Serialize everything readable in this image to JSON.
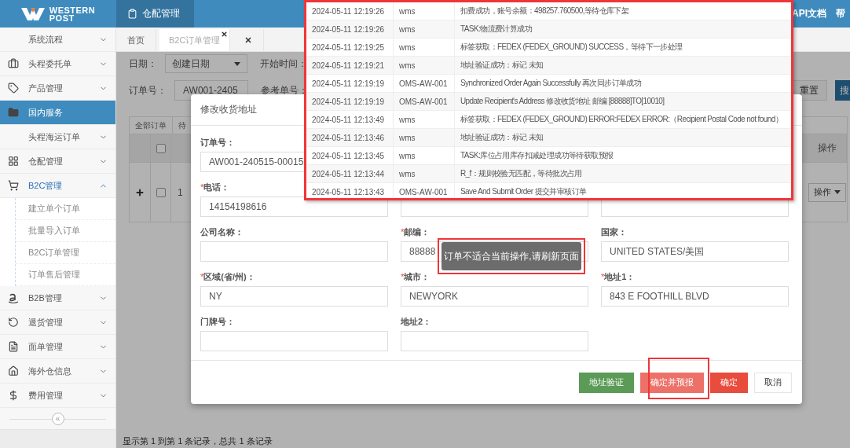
{
  "top_bar": {
    "logo": {
      "line_1": "WESTERN",
      "line_2": "POST"
    },
    "module_tab": "仓配管理",
    "links": [
      "API文档",
      "帮"
    ]
  },
  "sidebar": {
    "items": [
      {
        "label": "系统流程",
        "selected": false,
        "expanded": false
      },
      {
        "label": "头程委托单",
        "selected": false,
        "expanded": false
      },
      {
        "label": "产品管理",
        "selected": false,
        "expanded": false
      },
      {
        "label": "国内服务",
        "selected": true,
        "expanded": false
      },
      {
        "label": "头程海运订单",
        "selected": false,
        "expanded": false
      },
      {
        "label": "仓配管理",
        "selected": false,
        "expanded": false
      },
      {
        "label": "B2C管理",
        "selected": false,
        "expanded": true,
        "children": [
          {
            "label": "建立单个订单"
          },
          {
            "label": "批量导入订单"
          },
          {
            "label": "B2C订单管理"
          },
          {
            "label": "订单售后管理"
          }
        ]
      },
      {
        "label": "B2B管理",
        "selected": false,
        "expanded": false
      },
      {
        "label": "退货管理",
        "selected": false,
        "expanded": false
      },
      {
        "label": "面单管理",
        "selected": false,
        "expanded": false
      },
      {
        "label": "海外仓信息",
        "selected": false,
        "expanded": false
      },
      {
        "label": "费用管理",
        "selected": false,
        "expanded": false
      }
    ],
    "collapse_mark": "«"
  },
  "tabs": [
    {
      "label": "首页",
      "selected": false,
      "closable": false
    },
    {
      "label": "B2C订单管理",
      "selected": true,
      "closable": true
    },
    {
      "selected": false,
      "closable": true
    }
  ],
  "filters": {
    "date_label": "日期：",
    "date_select": "创建日期",
    "start_label": "开始时间：",
    "order_label": "订单号：",
    "order_value": "AW001-2405",
    "ref_label": "参考单号：",
    "reset_button": "重置",
    "search_button": "搜"
  },
  "table": {
    "status_tabs": [
      "全部订单",
      "待"
    ],
    "header_checked": false,
    "action_header": "操作",
    "rows": [
      {
        "index": "1",
        "checked": false,
        "action": "操作"
      }
    ]
  },
  "pager_text": "显示第 1 到第 1 条记录，总共 1 条记录",
  "modal": {
    "title": "修改收货地址",
    "required_mark": "*",
    "rows": [
      [
        {
          "label": "订单号：",
          "required": false,
          "value": "AW001-240515-00015"
        },
        null,
        null
      ],
      [
        {
          "label": "电话：",
          "required": true,
          "value": "14154198616"
        },
        {},
        {}
      ],
      [
        {
          "label": "公司名称：",
          "required": false
        },
        {
          "label": "邮编：",
          "required": true,
          "value": "88888"
        },
        {
          "label": "国家：",
          "required": false,
          "value": "UNITED STATES/美国"
        }
      ],
      [
        {
          "label": "区域(省/州)：",
          "required": true,
          "value": "NY"
        },
        {
          "label": "城市：",
          "required": true,
          "value": "NEWYORK"
        },
        {
          "label": "地址1：",
          "required": true,
          "value": "843 E FOOTHILL BLVD"
        }
      ],
      [
        {
          "label": "门牌号：",
          "required": false
        },
        {
          "label": "地址2：",
          "required": false
        },
        null
      ]
    ],
    "buttons": [
      {
        "label": "地址验证",
        "kind": "success"
      },
      {
        "label": "确定并预报",
        "kind": "light-danger"
      },
      {
        "label": "确定",
        "kind": "danger"
      },
      {
        "label": "取消",
        "kind": "default"
      }
    ]
  },
  "log": {
    "rows": [
      {
        "time": "2024-05-11 12:19:26",
        "source": "wms",
        "message": "扣费成功，账号余额：498257.760500,等待仓库下架"
      },
      {
        "time": "2024-05-11 12:19:26",
        "source": "wms",
        "message": "TASK:物流费计算成功"
      },
      {
        "time": "2024-05-11 12:19:25",
        "source": "wms",
        "message": "标签获取：FEDEX (FEDEX_GROUND) SUCCESS，等待下一步处理"
      },
      {
        "time": "2024-05-11 12:19:21",
        "source": "wms",
        "message": "地址验证成功：标记 未知"
      },
      {
        "time": "2024-05-11 12:19:19",
        "source": "OMS-AW-001",
        "message": "Synchronized Order Again Successfully 再次同步订单成功"
      },
      {
        "time": "2024-05-11 12:19:19",
        "source": "OMS-AW-001",
        "message": "Update Recipient's Address 修改收货地址 邮编 [88888]TO[10010]"
      },
      {
        "time": "2024-05-11 12:13:49",
        "source": "wms",
        "message": "标签获取：FEDEX (FEDEX_GROUND) ERROR:FEDEX ERROR:（Recipient Postal Code not found）"
      },
      {
        "time": "2024-05-11 12:13:46",
        "source": "wms",
        "message": "地址验证成功：标记 未知"
      },
      {
        "time": "2024-05-11 12:13:45",
        "source": "wms",
        "message": "TASK:库位占用库存扣减处理成功等待获取预报"
      },
      {
        "time": "2024-05-11 12:13:44",
        "source": "wms",
        "message": "R_f：规则校验无匹配，等待批次占用"
      },
      {
        "time": "2024-05-11 12:13:43",
        "source": "OMS-AW-001",
        "message": "Save And Submit Order 提交并审核订单"
      }
    ]
  },
  "toast": "订单不适合当前操作,请刷新页面"
}
